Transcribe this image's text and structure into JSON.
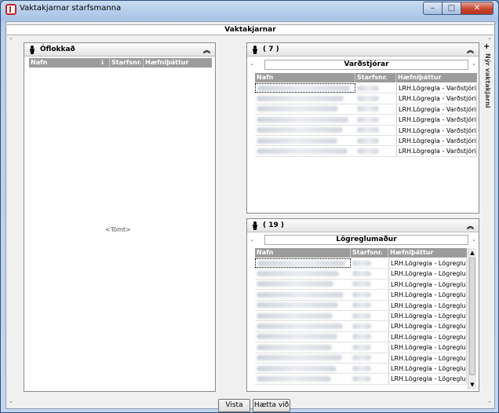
{
  "window": {
    "title": "Vaktakjarnar starfsmanna"
  },
  "header": {
    "title": "Vaktakjarnar"
  },
  "side_tab": {
    "label": "Nýr vaktakjarni"
  },
  "left_panel": {
    "title": "Óflokkað",
    "columns": [
      "Nafn",
      "Starfsnr.",
      "Hæfniþáttur"
    ],
    "sort_icon": "sort-indicator-icon",
    "empty_text": "<Tómt>"
  },
  "right_top": {
    "count": "( 7 )",
    "group": "Varðstjórar",
    "columns": [
      "Nafn",
      "Starfsnr.",
      "Hæfniþáttur"
    ],
    "rows": [
      {
        "skill": "LRH.Lögregla - Varðstjóri/ra"
      },
      {
        "skill": "LRH.Lögregla - Varðstjóri/ra"
      },
      {
        "skill": "LRH.Lögregla - Varðstjóri/ra"
      },
      {
        "skill": "LRH.Lögregla - Varðstjóri/ra"
      },
      {
        "skill": "LRH.Lögregla - Varðstjóri/ra"
      },
      {
        "skill": "LRH.Lögregla - Varðstjóri/ra"
      },
      {
        "skill": "LRH.Lögregla - Varðstjóri/ra"
      }
    ]
  },
  "right_bottom": {
    "count": "( 19 )",
    "group": "Lögreglumaður",
    "columns": [
      "Nafn",
      "Starfsnr.",
      "Hæfniþáttur"
    ],
    "rows": [
      {
        "skill": "LRH.Lögregla - Lögreglumä"
      },
      {
        "skill": "LRH.Lögregla - Lögreglumä"
      },
      {
        "skill": "LRH.Lögregla - Lögreglumä"
      },
      {
        "skill": "LRH.Lögregla - Lögreglumä"
      },
      {
        "skill": "LRH.Lögregla - Lögreglumä"
      },
      {
        "skill": "LRH.Lögregla - Lögreglumä"
      },
      {
        "skill": "LRH.Lögregla - Lögreglumä"
      },
      {
        "skill": "LRH.Lögregla - Lögreglumä"
      },
      {
        "skill": "LRH.Lögregla - Lögreglumä"
      },
      {
        "skill": "LRH.Lögregla - Lögreglumä"
      },
      {
        "skill": "LRH.Lögregla - Lögreglumä"
      },
      {
        "skill": "LRH.Lögregla - Lögreglumä"
      }
    ]
  },
  "footer": {
    "save_label": "Vista",
    "cancel_label": "Hætta við"
  },
  "colors": {
    "titlebar": "#a8c4e6",
    "close_button": "#c7472e",
    "grid_header": "#9c9c9c"
  }
}
